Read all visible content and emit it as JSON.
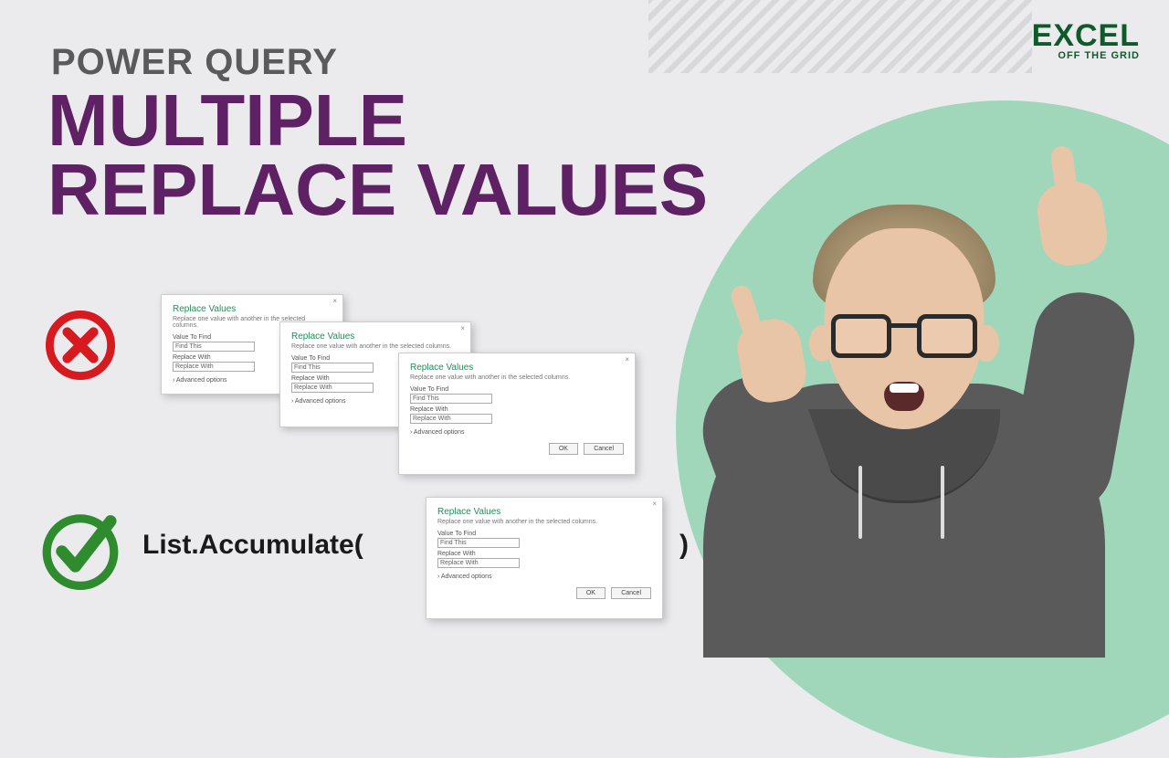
{
  "logo": {
    "main": "EXCEL",
    "sub": "OFF THE GRID"
  },
  "subtitle": "POWER QUERY",
  "title_line1": "MULTIPLE",
  "title_line2": "REPLACE VALUES",
  "function": {
    "name": "List.Accumulate(",
    "close": ")"
  },
  "dialog": {
    "title": "Replace Values",
    "subtitle": "Replace one value with another in the selected columns.",
    "label_find": "Value To Find",
    "value_find": "Find This",
    "label_replace": "Replace With",
    "value_replace": "Replace With",
    "advanced": "› Advanced options",
    "ok": "OK",
    "cancel": "Cancel"
  },
  "colors": {
    "title": "#5e2163",
    "subtitle": "#5a5a5a",
    "cross": "#d71920",
    "check": "#2e8b2e",
    "circle": "#a0d7bb",
    "logo": "#0f5a2a"
  }
}
